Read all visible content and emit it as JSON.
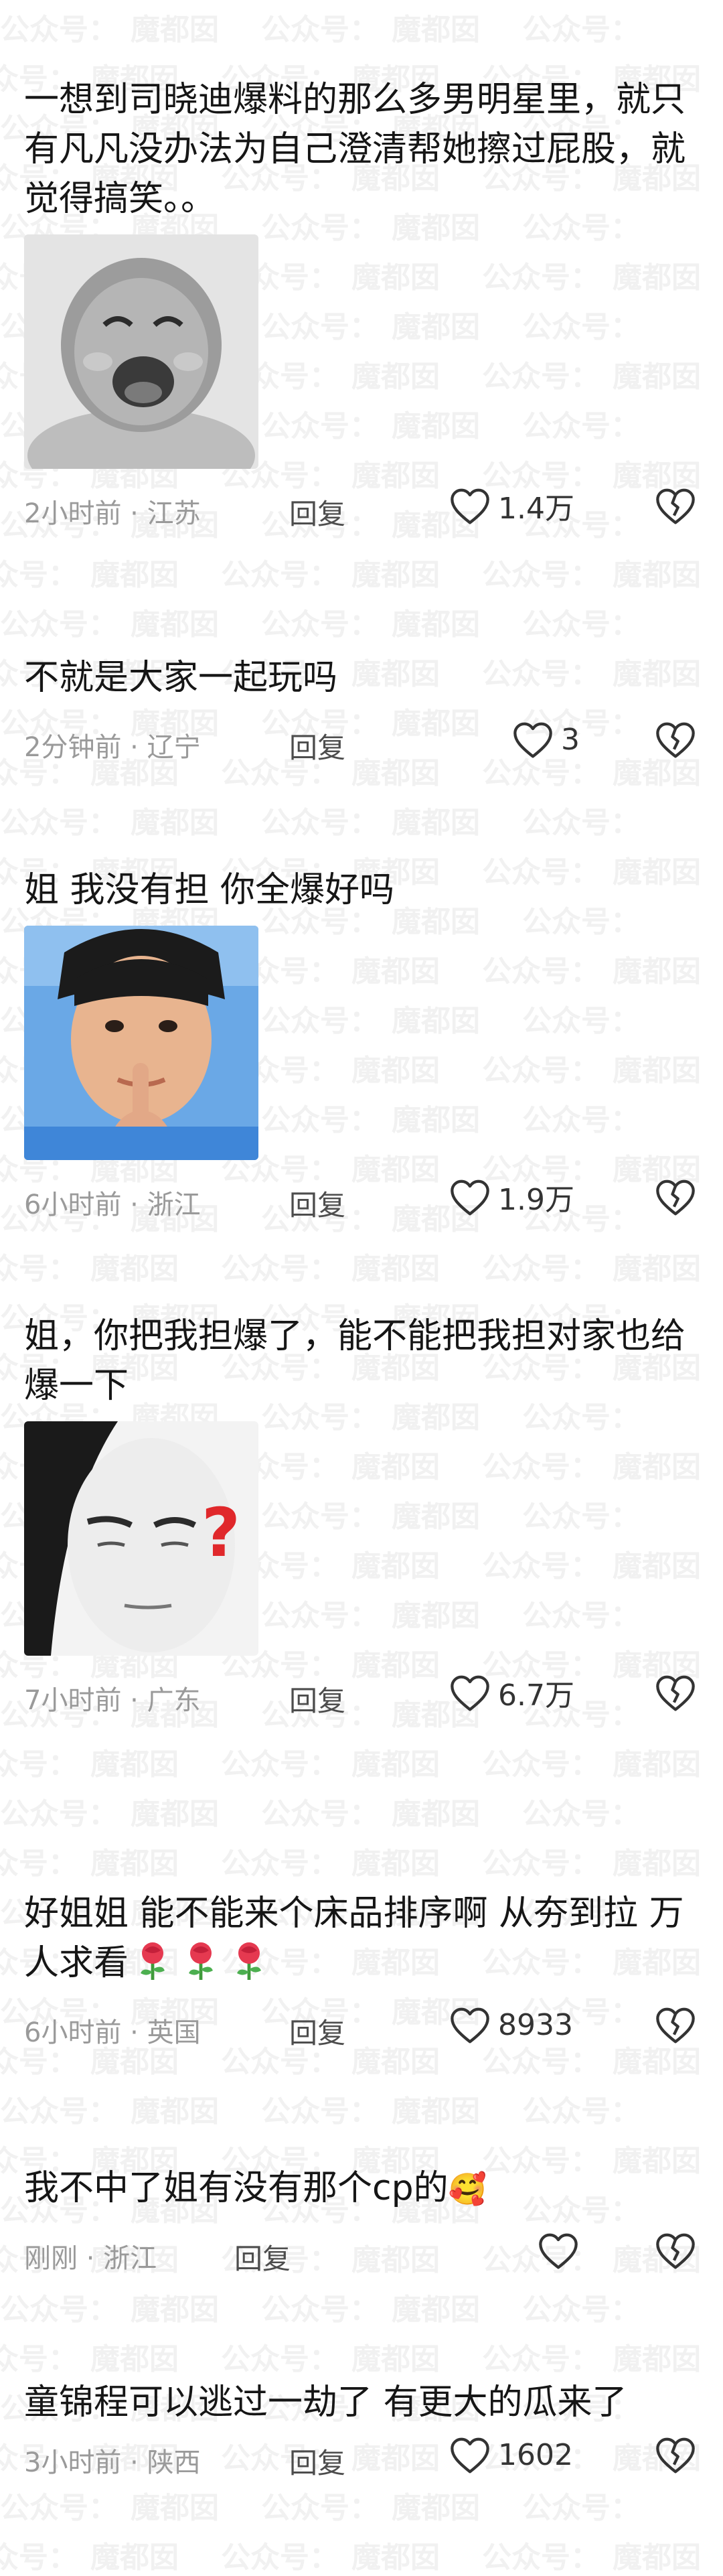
{
  "comments": [
    {
      "text": "一想到司晓迪爆料的那么多男明星里，就只有凡凡没办法为自己澄清帮她擦过屁股，就觉得搞笑。。",
      "time_loc": "2小时前 · 江苏",
      "reply": "回复",
      "likes": "1.4万",
      "sticker": "laughing-baby"
    },
    {
      "text": "不就是大家一起玩吗",
      "time_loc": "2分钟前 · 辽宁",
      "reply": "回复",
      "likes": "3"
    },
    {
      "text": "姐 我没有担 你全爆好吗",
      "time_loc": "6小时前 · 浙江",
      "reply": "回复",
      "likes": "1.9万",
      "sticker": "shush-man"
    },
    {
      "text": "姐，你把我担爆了，能不能把我担对家也给爆一下",
      "time_loc": "7小时前 · 广东",
      "reply": "回复",
      "likes": "6.7万",
      "sticker": "confused-face",
      "sticker_mark": "?"
    },
    {
      "text_a": "好姐姐 能不能来个床品排序啊 从夯到拉 万人求看",
      "emojis": [
        "rose",
        "rose",
        "rose"
      ],
      "time_loc": "6小时前 · 英国",
      "reply": "回复",
      "likes": "8933"
    },
    {
      "text_a": "我不中了姐有没有那个cp的",
      "emoji": "🥰",
      "time_loc": "刚刚 · 浙江",
      "reply": "回复",
      "likes": ""
    },
    {
      "text": "童锦程可以逃过一劫了 有更大的瓜来了",
      "time_loc": "3小时前 · 陕西",
      "reply": "回复",
      "likes": "1602"
    }
  ],
  "watermark": {
    "a": "公众号：",
    "b": "魔都囡"
  },
  "icons": {
    "like": "heart-outline-icon",
    "dislike": "broken-heart-icon"
  },
  "colors": {
    "text": "#161616",
    "meta": "#9a9a9a",
    "icon": "#333333",
    "question": "#e0282b"
  }
}
